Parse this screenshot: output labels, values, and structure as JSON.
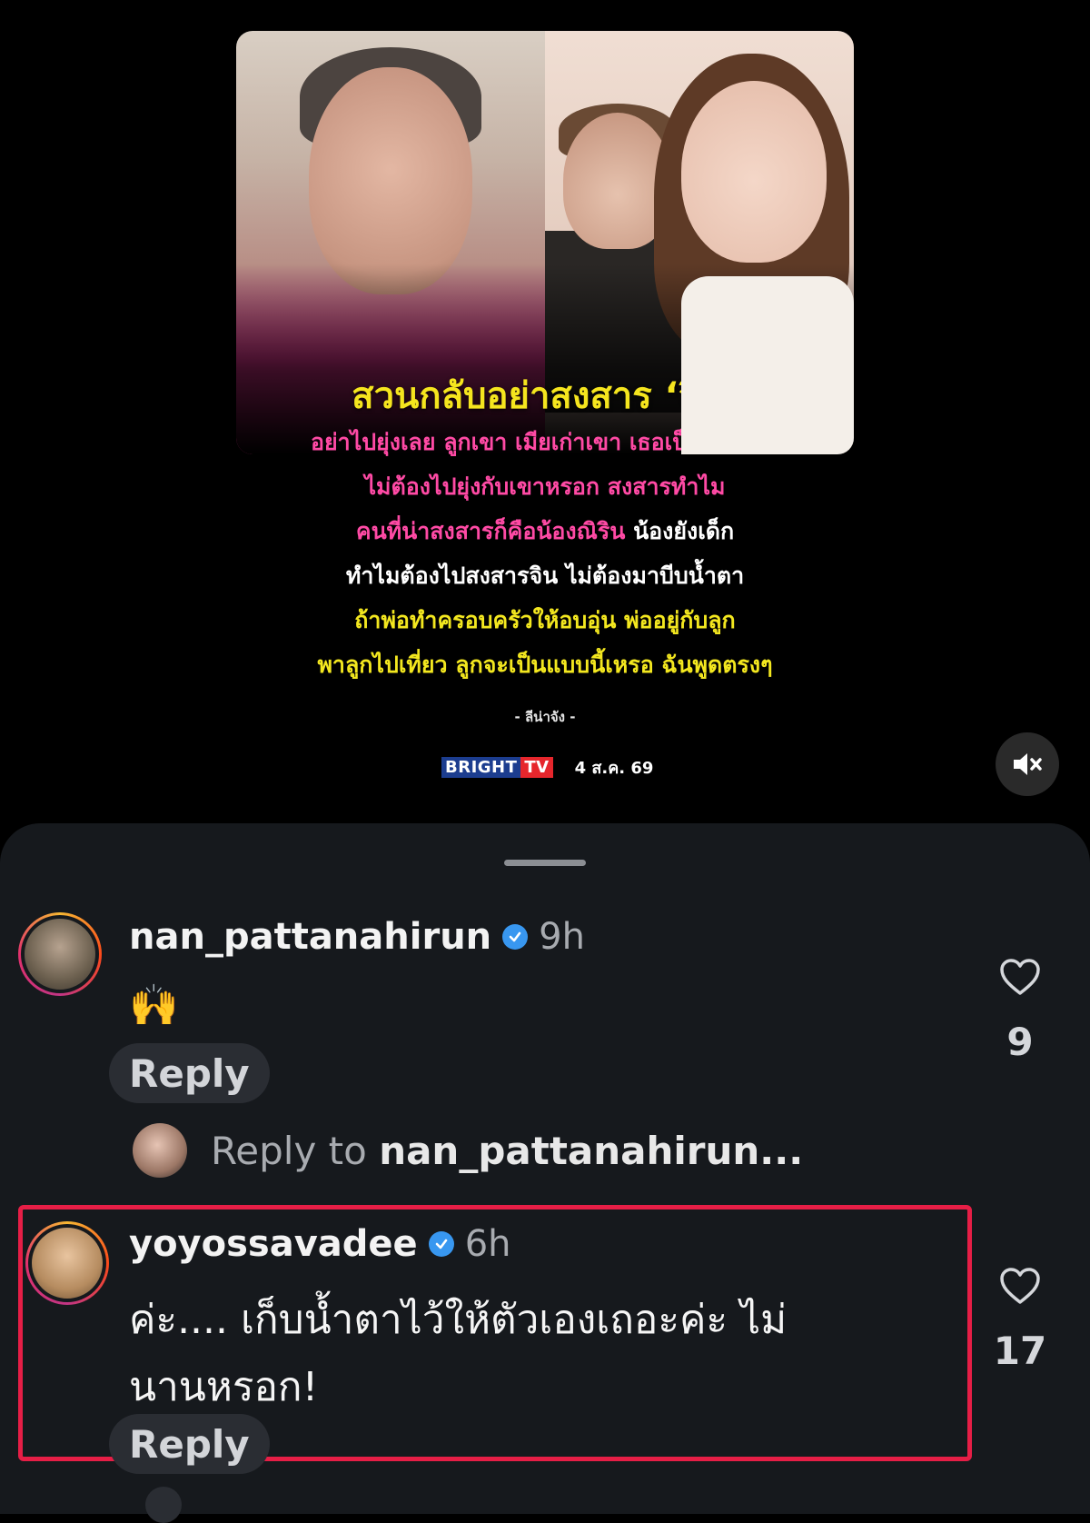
{
  "media": {
    "headline": "สวนกลับอย่าสงสาร ‘จิน’",
    "quote_lines": [
      {
        "text": "อย่าไปยุ่งเลย ลูกเขา เมียเก่าเขา เธอเป็นเมียใหม่",
        "color": "#ff4aa5"
      },
      {
        "text": "ไม่ต้องไปยุ่งกับเขาหรอก สงสารทำไม",
        "color": "#ff4aa5"
      },
      {
        "text_pink": "คนที่น่าสงสารก็คือน้องณิริน",
        "text_white": " น้องยังเด็ก"
      },
      {
        "text": "ทำไมต้องไปสงสารจิน ไม่ต้องมาบีบน้ำตา",
        "color": "#ffffff"
      },
      {
        "text": "ถ้าพ่อทำครอบครัวให้อบอุ่น พ่ออยู่กับลูก",
        "color": "#f3e71f"
      },
      {
        "text": "พาลูกไปเที่ยว ลูกจะเป็นแบบนี้เหรอ ฉันพูดตรงๆ",
        "color": "#f3e71f"
      }
    ],
    "attribution": "- ลีน่าจัง -",
    "brand_part1": "BRIGHT",
    "brand_part2": "TV",
    "date": "4 ส.ค. 69",
    "mute_icon": "speaker-muted-icon"
  },
  "comments": [
    {
      "username": "nan_pattanahirun",
      "time": "9h",
      "text": "🙌",
      "reply_label": "Reply",
      "likes": "9"
    },
    {
      "username": "yoyossavadee",
      "time": "6h",
      "text_line1": "ค่ะ.... เก็บน้ำตาไว้ให้ตัวเองเถอะค่ะ ไม่",
      "text_line2": "นานหรอก!",
      "reply_label": "Reply",
      "likes": "17"
    }
  ],
  "reply_to": {
    "prefix": "Reply to ",
    "target": "nan_pattanahirun..."
  },
  "colors": {
    "sheet_bg": "#16191d",
    "highlight_border": "#e61e46",
    "verified_blue": "#3897f0"
  }
}
